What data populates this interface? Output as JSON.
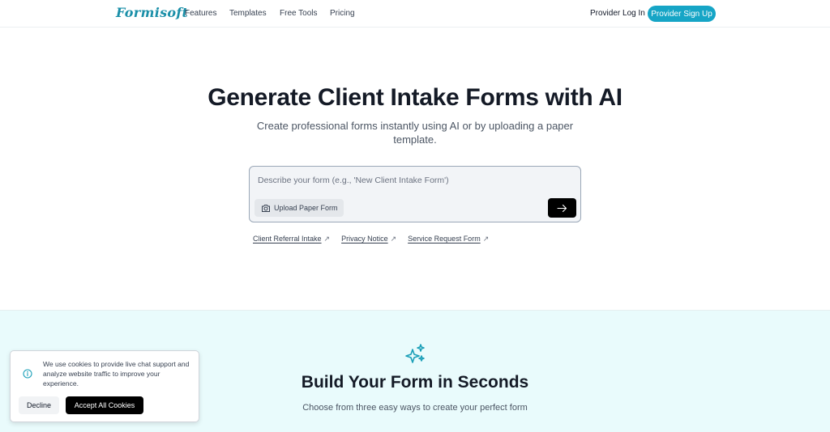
{
  "nav": {
    "logo": "Formisoft",
    "links": [
      "Features",
      "Templates",
      "Free Tools",
      "Pricing"
    ],
    "login": "Provider Log In",
    "signup": "Provider Sign Up"
  },
  "hero": {
    "title": "Generate Client Intake Forms with AI",
    "subtitle": "Create professional forms instantly using AI or by uploading a paper template.",
    "prompt_placeholder": "Describe your form (e.g., 'New Client Intake Form')",
    "upload_label": "Upload Paper Form",
    "suggestions": [
      "Client Referral Intake",
      "Privacy Notice",
      "Service Request Form"
    ]
  },
  "section2": {
    "title": "Build Your Form in Seconds",
    "subtitle": "Choose from three easy ways to create your perfect form"
  },
  "cookie": {
    "text": "We use cookies to provide live chat support and analyze website traffic to improve your experience.",
    "decline": "Decline",
    "accept": "Accept All Cookies"
  },
  "colors": {
    "brand": "#16a5c6",
    "logo": "#1a8fa8",
    "section_bg": "#e9fbfc",
    "dark_button": "#000000"
  },
  "icons": {
    "upload": "camera-icon",
    "send": "arrow-right-icon",
    "suggestion": "external-arrow-icon",
    "section": "sparkles-icon",
    "cookie": "info-icon"
  }
}
